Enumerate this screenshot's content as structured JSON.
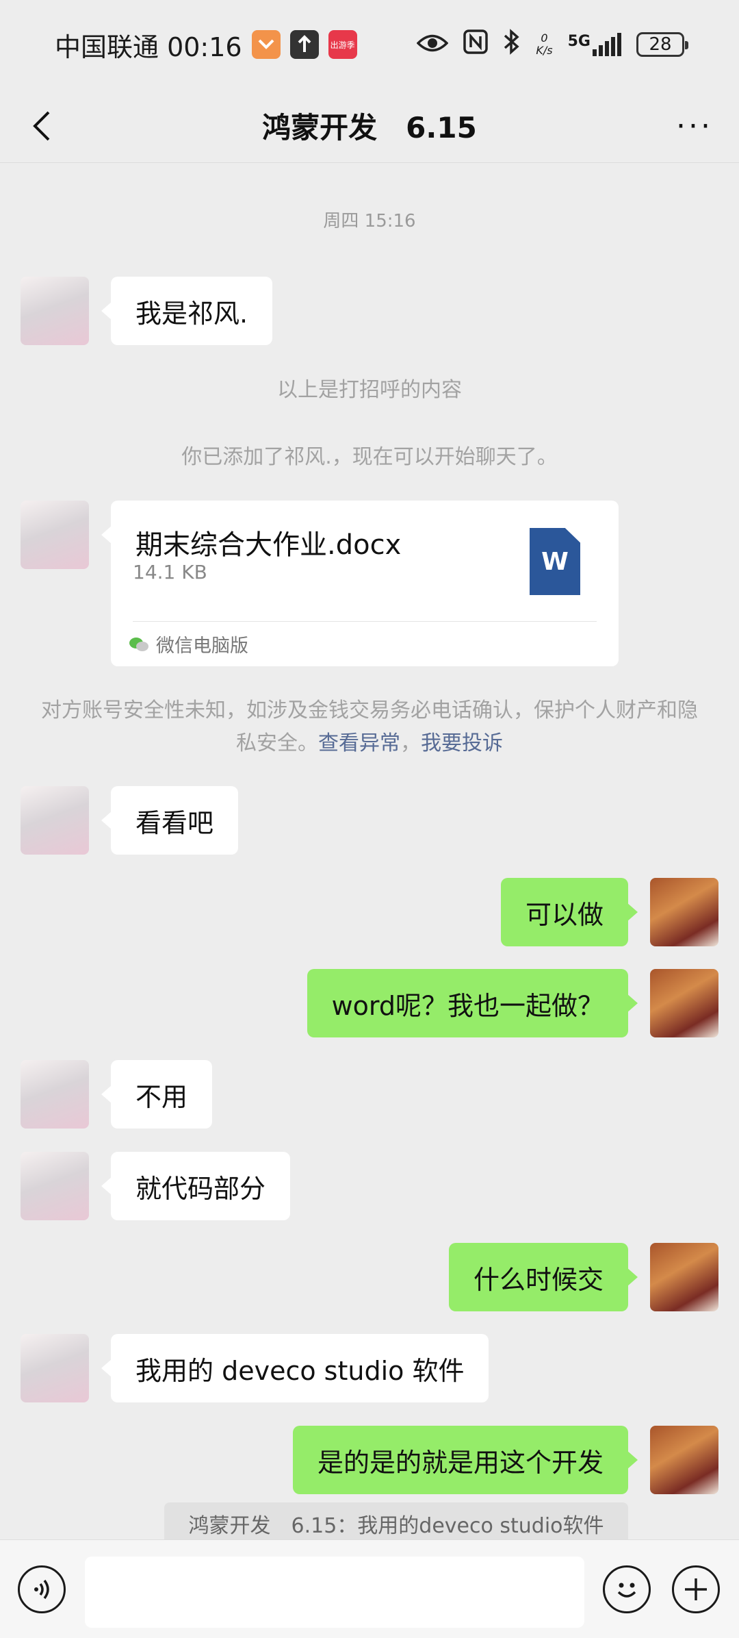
{
  "status_bar": {
    "carrier_time": "中国联通 00:16",
    "net_speed_value": "0",
    "net_speed_unit": "K/s",
    "signal_label": "5G",
    "battery": "28",
    "app_badge_3_label": "出游季"
  },
  "nav": {
    "title": "鸿蒙开发　6.15",
    "more": "···"
  },
  "chat": {
    "timestamp": "周四 15:16",
    "greeting_text": "我是祁风.",
    "sys_greeting_note": "以上是打招呼的内容",
    "sys_added_note": "你已添加了祁风.，现在可以开始聊天了。",
    "file": {
      "name": "期末综合大作业.docx",
      "size": "14.1 KB",
      "icon_letter": "W",
      "source": "微信电脑版"
    },
    "security_warning": "对方账号安全性未知，如涉及金钱交易务必电话确认，保护个人财产和隐私安全。",
    "link_view_anomaly": "查看异常",
    "link_separator": "，",
    "link_report": "我要投诉",
    "messages": [
      {
        "from": "friend",
        "text": "看看吧"
      },
      {
        "from": "me",
        "text": "可以做"
      },
      {
        "from": "me",
        "text": "word呢？我也一起做？"
      },
      {
        "from": "friend",
        "text": "不用"
      },
      {
        "from": "friend",
        "text": "就代码部分"
      },
      {
        "from": "me",
        "text": "什么时候交"
      },
      {
        "from": "friend",
        "text": "我用的 deveco studio 软件"
      },
      {
        "from": "me",
        "text": "是的是的就是用这个开发"
      }
    ],
    "quote": "鸿蒙开发　6.15：我用的deveco studio软件"
  },
  "input_bar": {
    "message_value": "",
    "voice_icon": "voice-icon",
    "emoji_icon": "emoji-icon",
    "plus_icon": "plus-icon"
  },
  "colors": {
    "background": "#ededed",
    "outgoing_bubble": "#95ec69",
    "incoming_bubble": "#ffffff",
    "link": "#576b95",
    "word_icon": "#2b579a"
  }
}
